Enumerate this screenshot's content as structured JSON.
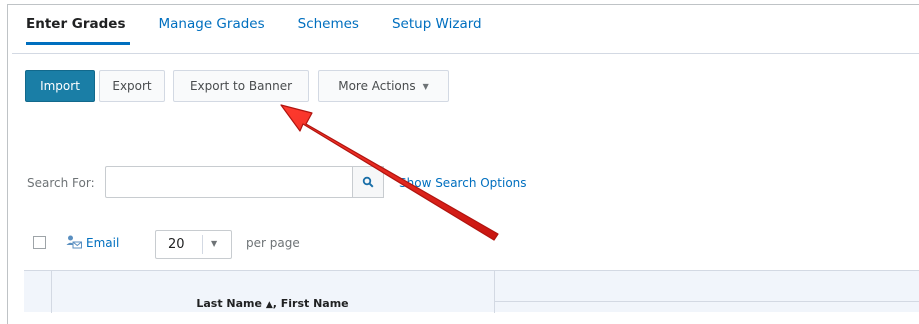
{
  "tabs": [
    {
      "label": "Enter Grades",
      "active": true
    },
    {
      "label": "Manage Grades",
      "active": false
    },
    {
      "label": "Schemes",
      "active": false
    },
    {
      "label": "Setup Wizard",
      "active": false
    }
  ],
  "toolbar": {
    "import_label": "Import",
    "export_label": "Export",
    "export_banner_label": "Export to Banner",
    "more_actions_label": "More Actions"
  },
  "search": {
    "label": "Search For:",
    "value": "",
    "options_label": "Show Search Options",
    "button_icon": "search-icon"
  },
  "list_controls": {
    "email_label": "Email",
    "per_page_value": "20",
    "per_page_label": "per page"
  },
  "table": {
    "name_header": "Last Name",
    "name_header_rest": ", First Name",
    "sort_indicator": "▲"
  },
  "annotation": {
    "arrow_color": "#e0201b",
    "target": "Export to Banner"
  },
  "colors": {
    "primary": "#1a7ea6",
    "link": "#006fbf",
    "header_bg": "#f1f5fb"
  }
}
